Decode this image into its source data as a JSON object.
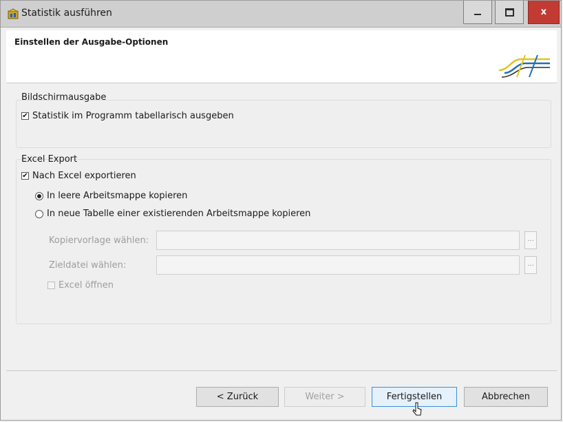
{
  "window": {
    "title": "Statistik ausführen",
    "controls": {
      "minimize": "—",
      "maximize": "□",
      "close": "x"
    }
  },
  "header": {
    "title": "Einstellen der Ausgabe-Optionen"
  },
  "screen_output": {
    "group_label": "Bildschirmausgabe",
    "table_checkbox": {
      "label": "Statistik im Programm tabellarisch ausgeben",
      "checked": true
    }
  },
  "excel_export": {
    "group_label": "Excel Export",
    "export_checkbox": {
      "label": "Nach Excel exportieren",
      "checked": true
    },
    "radio_empty": {
      "label": "In leere Arbeitsmappe kopieren",
      "selected": true
    },
    "radio_existing": {
      "label": "In neue Tabelle einer existierenden Arbeitsmappe kopieren",
      "selected": false
    },
    "template_label": "Kopiervorlage wählen:",
    "target_label": "Zieldatei wählen:",
    "browse_label": "...",
    "open_excel": {
      "label": "Excel öffnen",
      "checked": false
    }
  },
  "footer": {
    "back": "< Zurück",
    "next": "Weiter >",
    "finish": "Fertigstellen",
    "cancel": "Abbrechen"
  },
  "colors": {
    "titlebar": "#cfcfcf",
    "close_button": "#c23b33",
    "logo_yellow": "#e8c21a",
    "logo_blue": "#1d6fb8",
    "focus_border": "#3c8fd8"
  }
}
